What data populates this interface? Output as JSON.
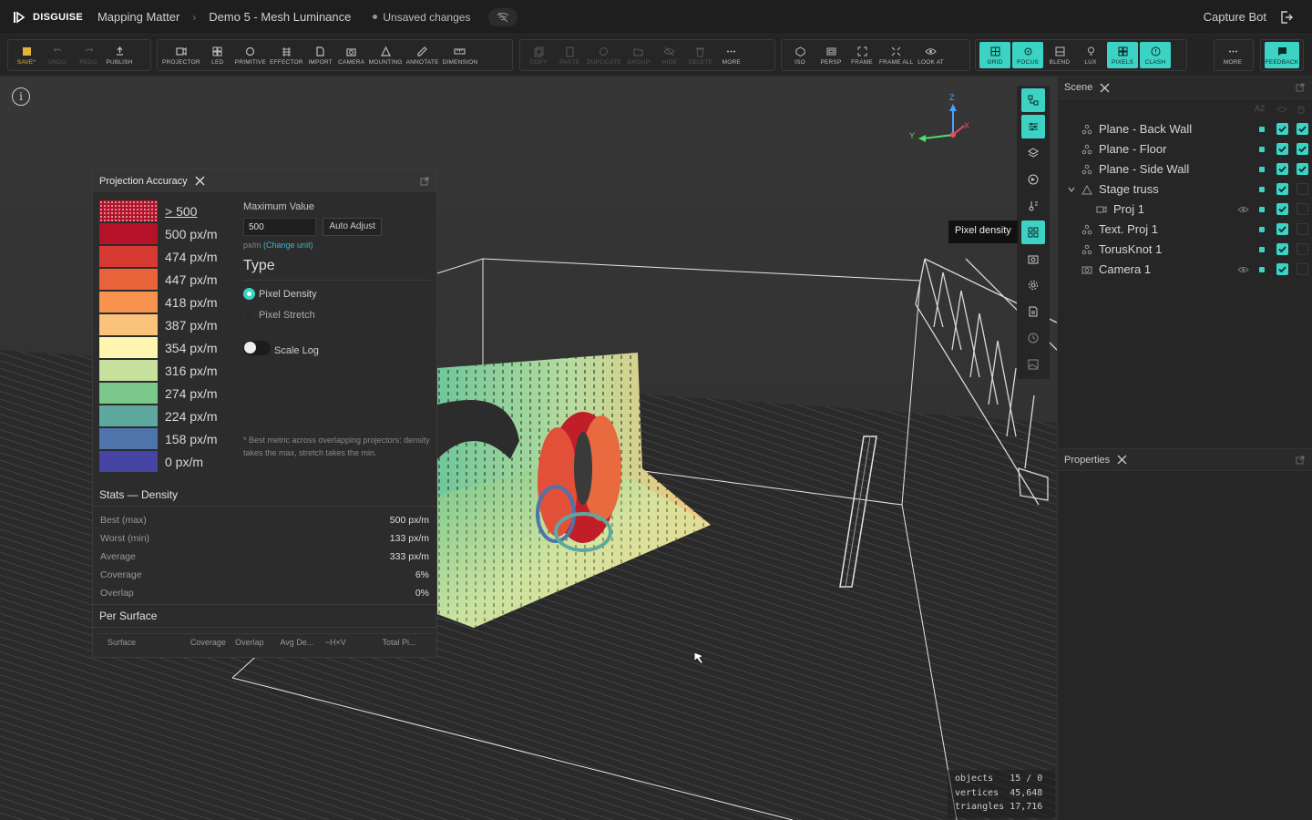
{
  "app": {
    "name": "DISGUISE"
  },
  "breadcrumb": [
    "Mapping Matter",
    "Demo 5 - Mesh Luminance"
  ],
  "unsaved": "Unsaved changes",
  "user": "Capture Bot",
  "toolbar": {
    "file": [
      "SAVE*",
      "UNDO",
      "REDO",
      "PUBLISH"
    ],
    "add": [
      "PROJECTOR",
      "LED",
      "PRIMITIVE",
      "EFFECTOR",
      "IMPORT",
      "CAMERA",
      "MOUNTING",
      "ANNOTATE",
      "DIMENSION"
    ],
    "edit": [
      "COPY",
      "PASTE",
      "DUPLICATE",
      "GROUP",
      "HIDE",
      "DELETE",
      "MORE"
    ],
    "view": [
      "ISO",
      "PERSP",
      "FRAME",
      "FRAME ALL",
      "LOOK AT"
    ],
    "overlays": [
      "GRID",
      "FOCUS",
      "BLEND",
      "LUX",
      "PIXELS",
      "CLASH"
    ],
    "more": "MORE",
    "feedback": "FEEDBACK"
  },
  "gizmo": {
    "z": "Z",
    "y": "Y",
    "x": "X"
  },
  "projection_panel": {
    "title": "Projection Accuracy",
    "legend": [
      {
        "label": "> 500",
        "color": "#b3142a"
      },
      {
        "label": "500 px/m",
        "color": "#b5122a"
      },
      {
        "label": "474 px/m",
        "color": "#d63a32"
      },
      {
        "label": "447 px/m",
        "color": "#e8633a"
      },
      {
        "label": "418 px/m",
        "color": "#f7934e"
      },
      {
        "label": "387 px/m",
        "color": "#fbc27c"
      },
      {
        "label": "354 px/m",
        "color": "#fdf5b0"
      },
      {
        "label": "316 px/m",
        "color": "#c8e29d"
      },
      {
        "label": "274 px/m",
        "color": "#7cc78b"
      },
      {
        "label": "224 px/m",
        "color": "#5ea8a0"
      },
      {
        "label": "158 px/m",
        "color": "#4f73ab"
      },
      {
        "label": "0 px/m",
        "color": "#4745a3"
      }
    ],
    "max_label": "Maximum Value",
    "max_value": "500",
    "auto_adjust": "Auto Adjust",
    "unit": "px/m",
    "change_unit": "(Change unit)",
    "type_label": "Type",
    "options": [
      "Pixel Density",
      "Pixel Stretch"
    ],
    "scale_log": "Scale Log",
    "note": "* Best metric across overlapping projectors: density takes the max, stretch takes the min.",
    "stats_title": "Stats — Density",
    "stats": [
      {
        "label": "Best (max)",
        "value": "500 px/m"
      },
      {
        "label": "Worst (min)",
        "value": "133 px/m"
      },
      {
        "label": "Average",
        "value": "333 px/m"
      },
      {
        "label": "Coverage",
        "value": "6%"
      },
      {
        "label": "Overlap",
        "value": "0%"
      }
    ],
    "per_surface_title": "Per Surface",
    "per_surface_columns": [
      "Surface",
      "Coverage",
      "Overlap",
      "Avg De...",
      "~H×V",
      "Total Pi..."
    ]
  },
  "tooltip": "Pixel density",
  "scene": {
    "title": "Scene",
    "sort_label": "AZ",
    "items": [
      {
        "name": "Plane - Back Wall",
        "indent": 0,
        "col1": true,
        "col2": true,
        "eye": false
      },
      {
        "name": "Plane - Floor",
        "indent": 0,
        "col1": true,
        "col2": true,
        "eye": false
      },
      {
        "name": "Plane - Side Wall",
        "indent": 0,
        "col1": true,
        "col2": true,
        "eye": false
      },
      {
        "name": "Stage truss",
        "indent": 0,
        "col1": true,
        "col2": false,
        "eye": false
      },
      {
        "name": "Proj 1",
        "indent": 1,
        "col1": true,
        "col2": false,
        "eye": true
      },
      {
        "name": "Text. Proj 1",
        "indent": 0,
        "col1": true,
        "col2": false,
        "eye": false
      },
      {
        "name": "TorusKnot 1",
        "indent": 0,
        "col1": true,
        "col2": false,
        "eye": false
      },
      {
        "name": "Camera 1",
        "indent": 0,
        "col1": true,
        "col2": false,
        "eye": true
      }
    ]
  },
  "properties": {
    "title": "Properties"
  },
  "hud": "objects   15 / 0\nvertices  45,648\ntriangles 17,716"
}
